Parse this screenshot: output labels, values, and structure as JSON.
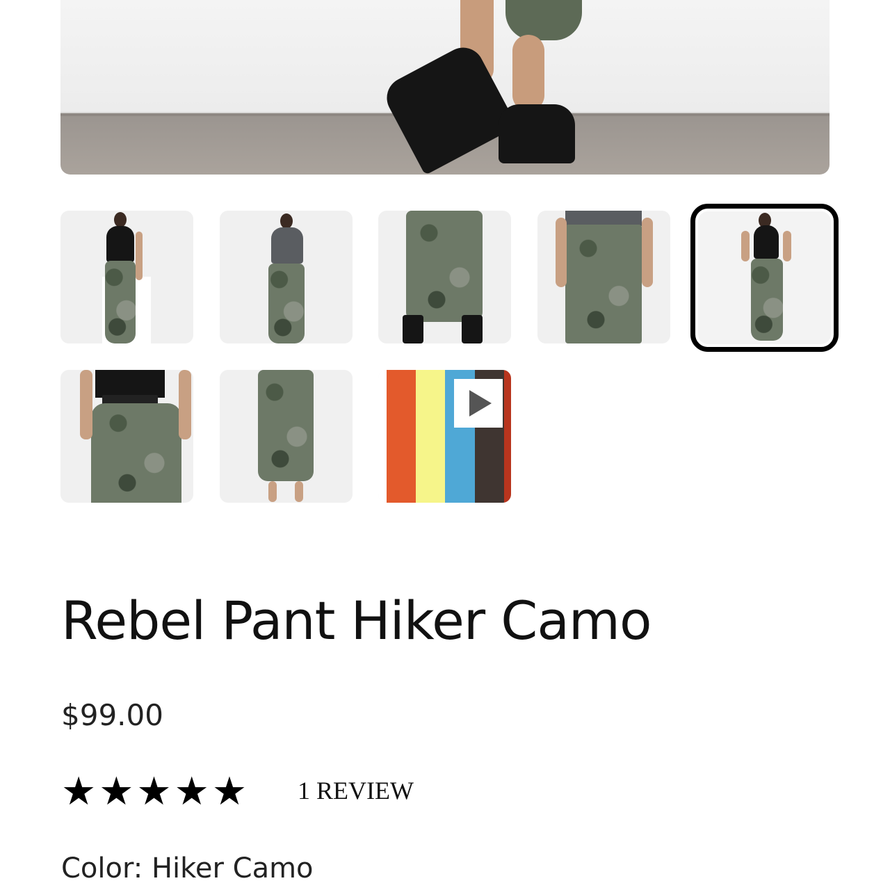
{
  "product": {
    "title": "Rebel Pant Hiker Camo",
    "price": "$99.00",
    "rating": {
      "stars": 5,
      "max_stars": 5,
      "reviews_label": "1 REVIEW"
    },
    "color_label": "Color:",
    "color_value": "Hiker Camo"
  },
  "gallery": {
    "thumbnail_count": 8,
    "selected_index": 4,
    "video_colors": [
      "#e35a2c",
      "#f6f58a",
      "#4fa8d6",
      "#3f3531",
      "#b8351e"
    ]
  }
}
